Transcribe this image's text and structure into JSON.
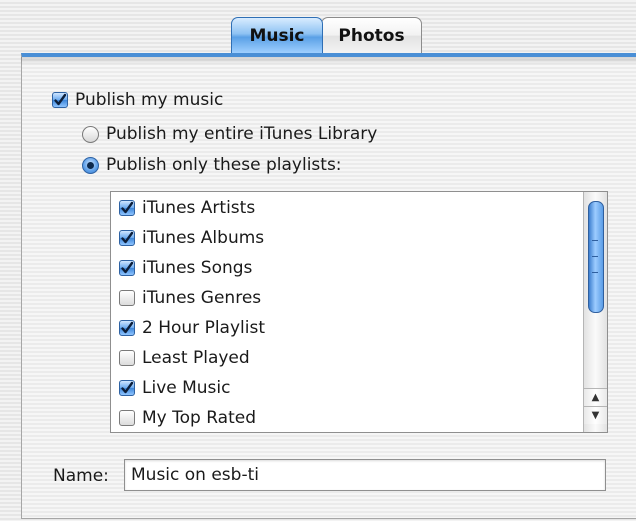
{
  "tabs": [
    {
      "label": "Music",
      "selected": true
    },
    {
      "label": "Photos",
      "selected": false
    }
  ],
  "publish": {
    "label": "Publish my music",
    "checked": true
  },
  "scope_options": [
    {
      "label": "Publish my entire iTunes Library",
      "selected": false
    },
    {
      "label": "Publish only these playlists:",
      "selected": true
    }
  ],
  "playlists": [
    {
      "label": "iTunes Artists",
      "checked": true
    },
    {
      "label": "iTunes Albums",
      "checked": true
    },
    {
      "label": "iTunes Songs",
      "checked": true
    },
    {
      "label": "iTunes Genres",
      "checked": false
    },
    {
      "label": "2 Hour Playlist",
      "checked": true
    },
    {
      "label": "Least Played",
      "checked": false
    },
    {
      "label": "Live Music",
      "checked": true
    },
    {
      "label": "My Top Rated",
      "checked": false
    }
  ],
  "name_field": {
    "label": "Name:",
    "value": "Music on esb-ti"
  },
  "icons": {
    "checkmark": "checkmark-icon",
    "scroll_up": "arrow-up-icon",
    "scroll_down": "arrow-down-icon"
  },
  "colors": {
    "accent": "#4a8fd6",
    "selected_blue": "#5aa0e6"
  }
}
